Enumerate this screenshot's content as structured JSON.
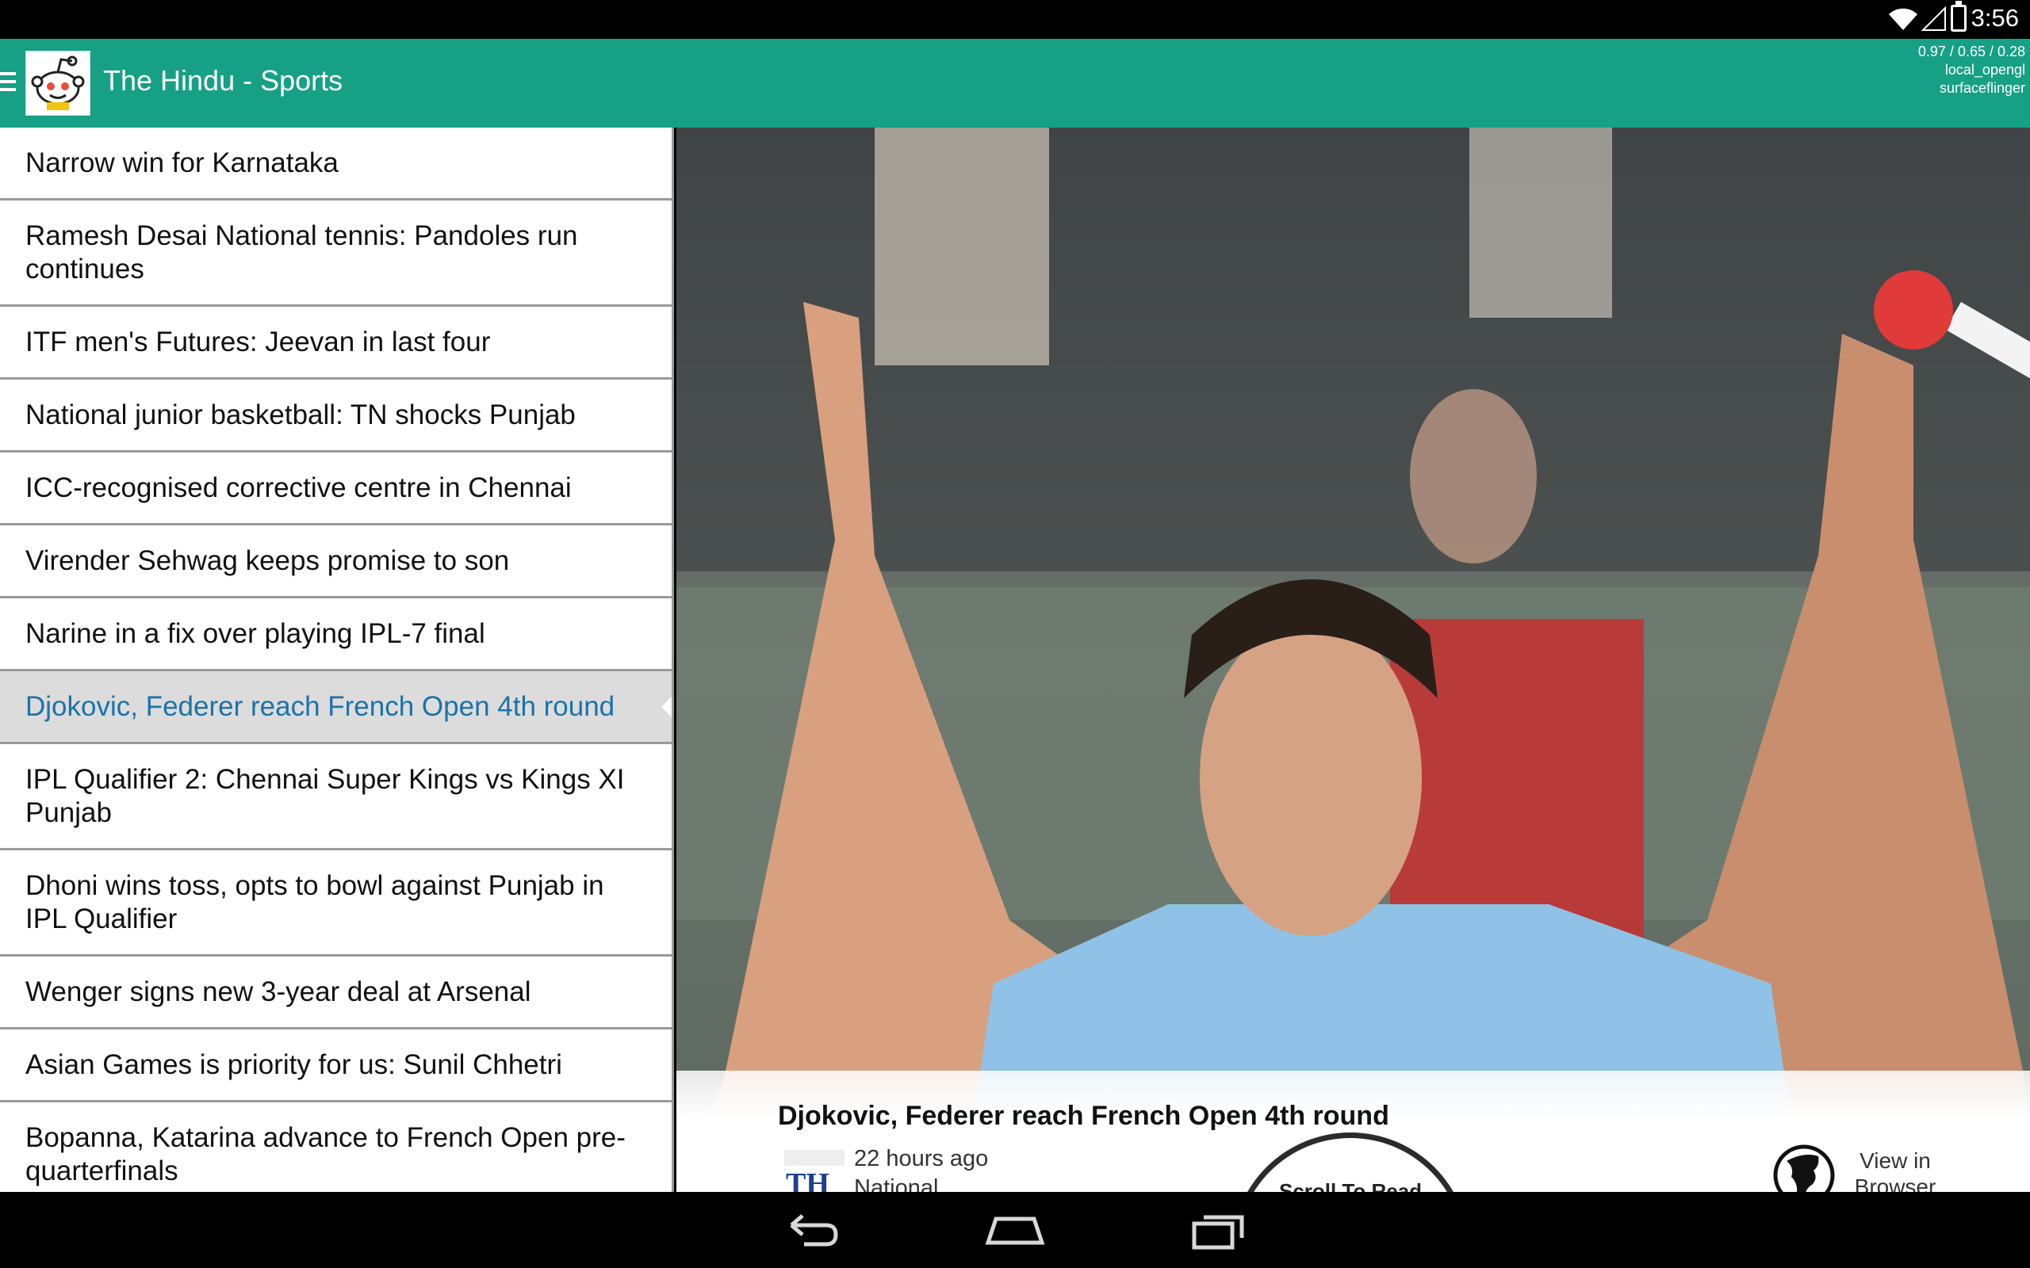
{
  "status_bar": {
    "clock": "3:56"
  },
  "action_bar": {
    "title": "The Hindu - Sports",
    "debug_lines": [
      "0.97 / 0.65 / 0.28",
      "local_opengl",
      "surfaceflinger"
    ]
  },
  "articles": [
    {
      "title": "Narrow win for Karnataka"
    },
    {
      "title": "Ramesh Desai National tennis: Pandoles run continues"
    },
    {
      "title": "ITF men's Futures: Jeevan in last four"
    },
    {
      "title": "National junior basketball: TN shocks Punjab"
    },
    {
      "title": "ICC-recognised corrective centre in Chennai"
    },
    {
      "title": "Virender Sehwag keeps promise to son"
    },
    {
      "title": "Narine in a fix over playing IPL-7 final"
    },
    {
      "title": "Djokovic, Federer reach French Open 4th round"
    },
    {
      "title": "IPL Qualifier 2: Chennai Super Kings vs Kings XI Punjab"
    },
    {
      "title": "Dhoni wins toss, opts to bowl against Punjab in IPL Qualifier"
    },
    {
      "title": "Wenger signs new 3-year deal at Arsenal"
    },
    {
      "title": "Asian Games is priority for us: Sunil Chhetri"
    },
    {
      "title": "Bopanna, Katarina advance to French Open pre-quarterfinals"
    }
  ],
  "selected_index": 7,
  "detail": {
    "title": "Djokovic, Federer reach French Open 4th round",
    "time_ago": "22 hours ago",
    "category": "National",
    "scroll_label": "Scroll To Read",
    "view_browser_label": "View in Browser",
    "source_logo_text": "TH"
  },
  "colors": {
    "accent": "#16a085",
    "selected_text": "#1a73a8",
    "selected_bg": "#dcdcdc"
  },
  "icons": [
    "menu-icon",
    "app-logo-icon",
    "wifi-icon",
    "battery-icon",
    "globe-icon",
    "back-icon",
    "home-icon",
    "recents-icon"
  ]
}
